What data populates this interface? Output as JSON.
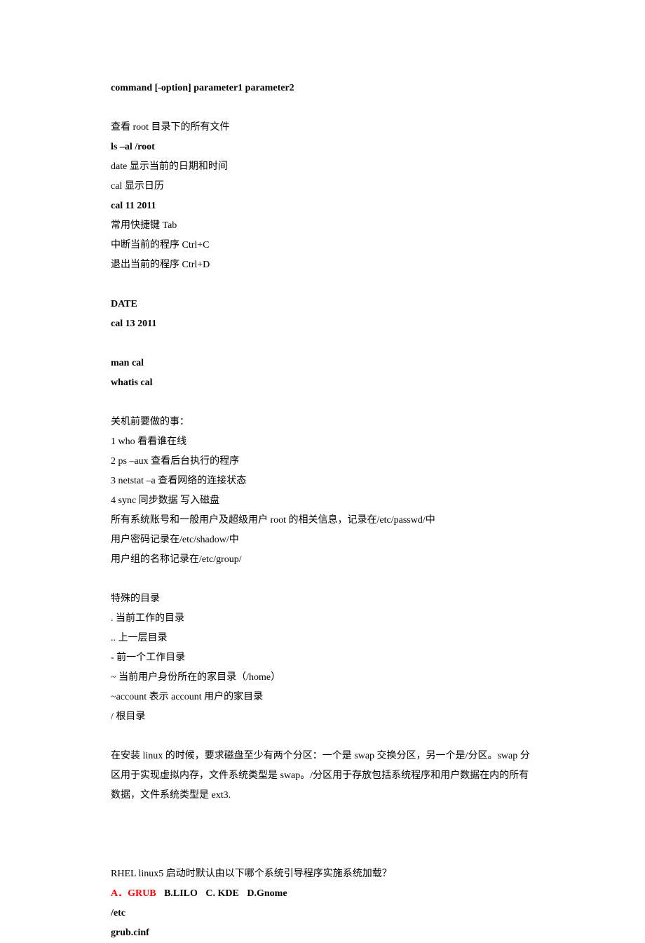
{
  "line1": "command [-option] parameter1 parameter2",
  "block2": {
    "l1": "查看 root 目录下的所有文件",
    "l2": "ls –al /root",
    "l3": "date  显示当前的日期和时间",
    "l4": "cal  显示日历",
    "l5": "cal 11 2011",
    "l6": "常用快捷键 Tab",
    "l7": "中断当前的程序  Ctrl+C",
    "l8": "退出当前的程序  Ctrl+D"
  },
  "block3": {
    "l1": "DATE",
    "l2": "cal 13 2011"
  },
  "block4": {
    "l1": "man cal",
    "l2": "whatis cal"
  },
  "block5": {
    "l1": "关机前要做的事：",
    "l2": "1 who  看看谁在线",
    "l3": "2 ps –aux  查看后台执行的程序",
    "l4": "3 netstat –a  查看网络的连接状态",
    "l5": "4 sync  同步数据  写入磁盘",
    "l6": "所有系统账号和一般用户及超级用户 root 的相关信息，记录在/etc/passwd/中",
    "l7": "用户密码记录在/etc/shadow/中",
    "l8": "用户组的名称记录在/etc/group/"
  },
  "block6": {
    "l1": "特殊的目录",
    "l2": ".  当前工作的目录",
    "l3": "..  上一层目录",
    "l4": "-      前一个工作目录",
    "l5": "~  当前用户身份所在的家目录（/home）",
    "l6": "~account  表示 account 用户的家目录",
    "l7": "/  根目录"
  },
  "block7": {
    "l1": "在安装 linux 的时候，要求磁盘至少有两个分区：一个是 swap 交换分区，另一个是/分区。swap 分区用于实现虚拟内存，文件系统类型是 swap。/分区用于存放包括系统程序和用户数据在内的所有数据，文件系统类型是 ext3."
  },
  "block8": {
    "q": "RHEL linux5  启动时默认由以下哪个系统引导程序实施系统加载？",
    "a": "A．GRUB",
    "b": "B.LILO",
    "c": "C. KDE",
    "d": "D.Gnome",
    "l3": "/etc",
    "l4": "grub.cinf"
  }
}
